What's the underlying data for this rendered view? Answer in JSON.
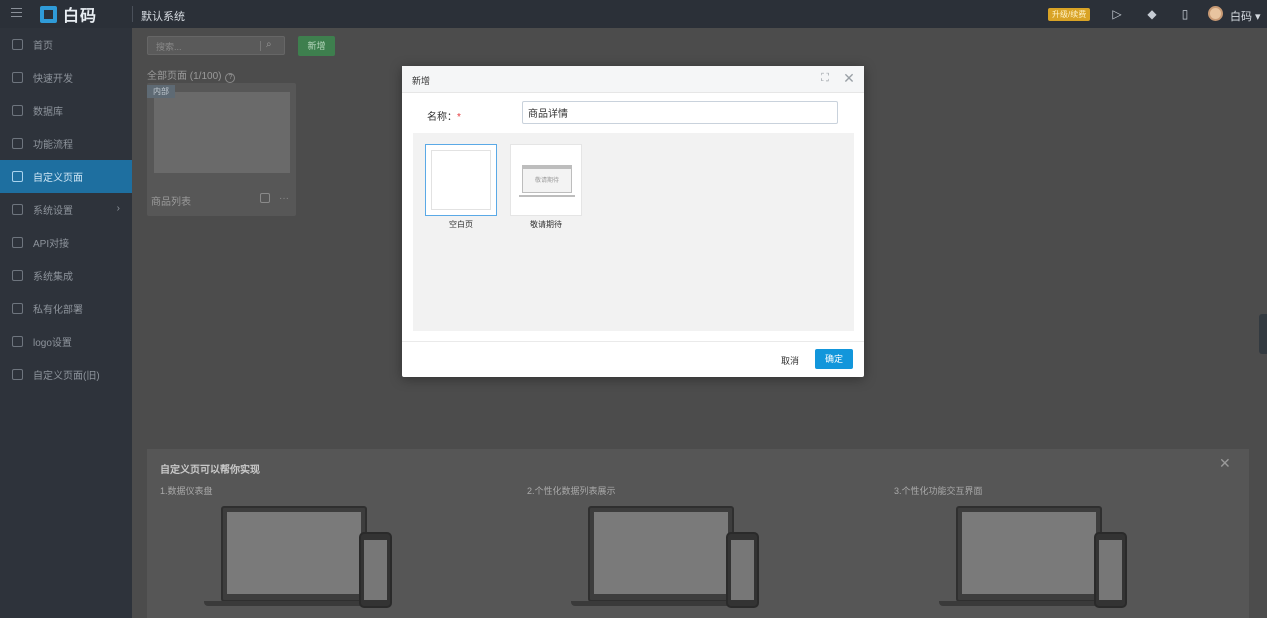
{
  "app": {
    "brand": "白码",
    "system_name": "默认系统"
  },
  "topbar": {
    "badge": "升级/续费",
    "user": "白码 ▾"
  },
  "sidebar": {
    "items": [
      {
        "label": "首页",
        "active": false
      },
      {
        "label": "快速开发",
        "active": false
      },
      {
        "label": "数据库",
        "active": false
      },
      {
        "label": "功能流程",
        "active": false
      },
      {
        "label": "自定义页面",
        "active": true
      },
      {
        "label": "系统设置",
        "active": false,
        "has_children": true
      },
      {
        "label": "API对接",
        "active": false
      },
      {
        "label": "系统集成",
        "active": false
      },
      {
        "label": "私有化部署",
        "active": false
      },
      {
        "label": "logo设置",
        "active": false
      },
      {
        "label": "自定义页面(旧)",
        "active": false
      }
    ]
  },
  "content": {
    "search_placeholder": "搜索...",
    "new_button": "新增",
    "pages_label": "全部页面 (1/100)",
    "card": {
      "tag": "内部",
      "name": "商品列表"
    },
    "promo": {
      "title": "自定义页可以帮你实现",
      "features": [
        "1.数据仪表盘",
        "2.个性化数据列表展示",
        "3.个性化功能交互界面"
      ]
    }
  },
  "modal": {
    "title": "新增",
    "name_label": "名称：",
    "required_mark": "*",
    "name_value": "商品详情",
    "templates": [
      {
        "label": "空白页",
        "selected": true
      },
      {
        "label": "敬请期待",
        "selected": false,
        "preview_text": "敬请期待"
      }
    ],
    "cancel_label": "取消",
    "ok_label": "确定"
  },
  "colors": {
    "primary": "#1296db",
    "sidebar_active": "#1e6fa0",
    "required": "#e4393c",
    "badge": "#d9a326"
  }
}
